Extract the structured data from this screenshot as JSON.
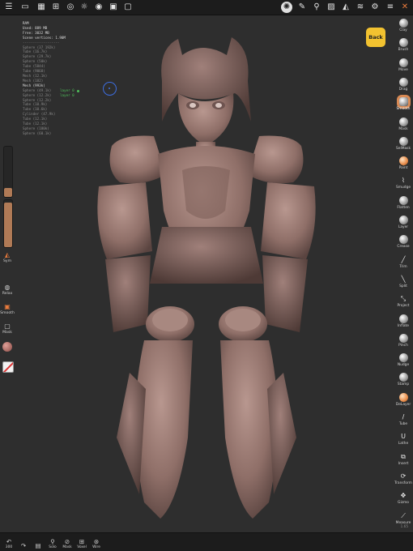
{
  "topbar": {
    "icons": [
      "menu-icon",
      "folder-icon",
      "grid-icon",
      "sphere-icon",
      "sun-icon",
      "target-icon",
      "image-icon",
      "camera-icon",
      "brush-settings-icon",
      "pen-icon",
      "eyedropper-icon",
      "photo-icon",
      "triangle-icon",
      "layers-icon",
      "gear-icon",
      "sliders-icon",
      "brush-icon"
    ]
  },
  "stats": {
    "lines": [
      "RAM",
      "Used: 889 MB",
      "Free: 3032 MB",
      "Scene vertices: 1.90M",
      "------------------",
      "Sphere (37 192k)",
      "Tube (16.7k)",
      "Sphere (29.7k)",
      "Sphere (50k)",
      "Tube (5844)",
      "Tube (9068)",
      "Mesh (12.1k)",
      "Mesh (182)",
      "Mesh (993k)",
      "Sphere (49.1k)",
      "Sphere (12.2k)",
      "Sphere (12.2k)",
      "Tube (10.9k)",
      "Tube (10.6k)",
      "Cylinder (47.9k)",
      "Tube (12.1k)",
      "Tube (12.1k)",
      "Sphere (180k)",
      "Sphere (60.1k)"
    ],
    "layer_labels": [
      "layer 0",
      "layer 0"
    ]
  },
  "left_panel": {
    "radius_fraction": 0.18,
    "intensity_fraction": 0.95,
    "sym_label": "Sym",
    "relax_label": "Relax",
    "smooth_label": "Smooth",
    "mask_label": "Mask",
    "color_swatch": "#b7756c"
  },
  "back_label": "Back",
  "tools": [
    {
      "label": "Clay",
      "icon": "ball"
    },
    {
      "label": "Brush",
      "icon": "ball"
    },
    {
      "label": "Move",
      "icon": "ball"
    },
    {
      "label": "Drag",
      "icon": "ball"
    },
    {
      "label": "Smooth",
      "icon": "ball",
      "selected": true
    },
    {
      "label": "Mask",
      "icon": "ball"
    },
    {
      "label": "SelMask",
      "icon": "ball"
    },
    {
      "label": "Paint",
      "icon": "ball-orange"
    },
    {
      "label": "Smudge",
      "icon": "glyph",
      "glyph": "⌇"
    },
    {
      "label": "Flatten",
      "icon": "ball"
    },
    {
      "label": "Layer",
      "icon": "ball"
    },
    {
      "label": "Crease",
      "icon": "ball"
    },
    {
      "label": "Trim",
      "icon": "glyph",
      "glyph": "╱"
    },
    {
      "label": "Split",
      "icon": "glyph",
      "glyph": "╲"
    },
    {
      "label": "Project",
      "icon": "glyph",
      "glyph": "⤡"
    },
    {
      "label": "Inflate",
      "icon": "ball"
    },
    {
      "label": "Pinch",
      "icon": "ball"
    },
    {
      "label": "Nudge",
      "icon": "ball"
    },
    {
      "label": "Stamp",
      "icon": "ball"
    },
    {
      "label": "DeLayer",
      "icon": "ball-orange"
    },
    {
      "label": "Tube",
      "icon": "glyph",
      "glyph": "/"
    },
    {
      "label": "Lathe",
      "icon": "glyph",
      "glyph": "Ս"
    },
    {
      "label": "Insert",
      "icon": "glyph",
      "glyph": "⧉"
    },
    {
      "label": "Transform",
      "icon": "glyph",
      "glyph": "⟳"
    },
    {
      "label": "Gizmo",
      "icon": "glyph",
      "glyph": "✥"
    },
    {
      "label": "Measure",
      "icon": "glyph",
      "glyph": "⟋"
    }
  ],
  "version": "1.65",
  "bottombar": {
    "undo_count": "300",
    "items": [
      "Solo",
      "Mask",
      "Voxel",
      "Wire"
    ]
  },
  "colors": {
    "accent": "#e87a3c",
    "back_button": "#f2c230",
    "cursor": "#3d6ee0",
    "model": "#9b7a72",
    "layer_text": "#4fbf5a"
  }
}
